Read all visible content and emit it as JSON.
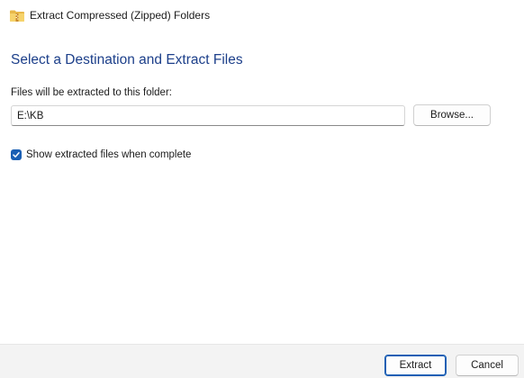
{
  "window": {
    "title": "Extract Compressed (Zipped) Folders",
    "icon": "zip-folder-icon"
  },
  "main": {
    "heading": "Select a Destination and Extract Files",
    "destination_label": "Files will be extracted to this folder:",
    "destination_value": "E:\\KB",
    "browse_label": "Browse...",
    "show_files_label": "Show extracted files when complete",
    "show_files_checked": true
  },
  "footer": {
    "extract_label": "Extract",
    "cancel_label": "Cancel"
  },
  "colors": {
    "accent": "#1a5fb4",
    "heading": "#1c3f8a",
    "footer_bg": "#f3f3f3"
  }
}
